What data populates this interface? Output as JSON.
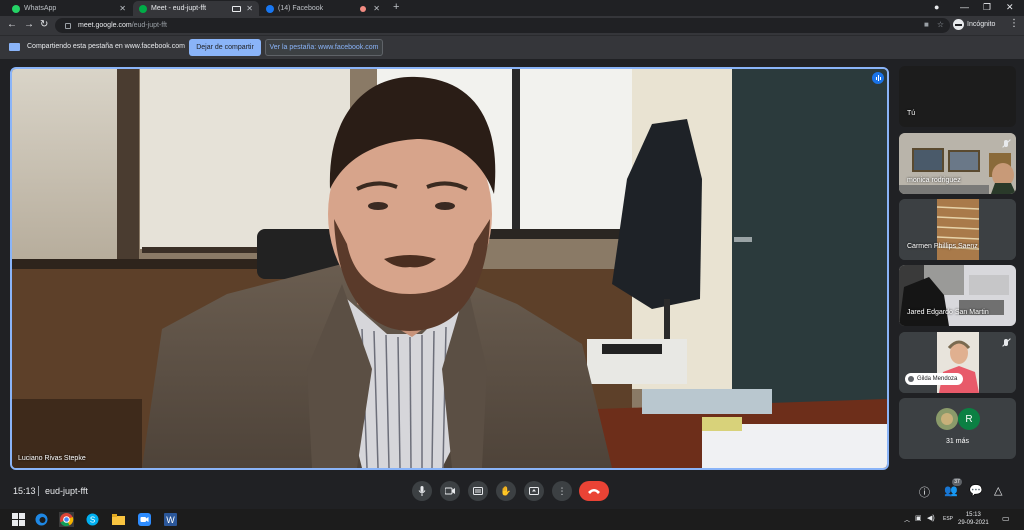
{
  "browser": {
    "tabs": [
      {
        "title": "WhatsApp",
        "favicon_color": "#25d366",
        "active": false
      },
      {
        "title": "Meet - eud-jupt-fft",
        "favicon_color": "#00ac47",
        "active": true
      },
      {
        "title": "(14) Facebook",
        "favicon_color": "#1877f2",
        "active": false
      }
    ],
    "new_tab_label": "+",
    "url_host": "meet.google.com",
    "url_path": "/eud-jupt-fft",
    "profile_label": "Incógnito"
  },
  "share_bar": {
    "message": "Compartiendo esta pestaña en www.facebook.com",
    "stop_label": "Dejar de compartir",
    "view_label": "Ver la pestaña: www.facebook.com"
  },
  "meeting": {
    "time": "15:13",
    "code": "eud-jupt-fft",
    "main_speaker": "Luciano Rivas Stepke",
    "participants": [
      {
        "name": "Tú",
        "muted": false
      },
      {
        "name": "monica rodriguez",
        "muted": true
      },
      {
        "name": "Carmen Phillips Saenz",
        "muted": false
      },
      {
        "name": "Jared Edgardo San Martin",
        "muted": false
      },
      {
        "name": "Gilda Mendoza",
        "muted": true
      }
    ],
    "more_tile": {
      "avatar_letter": "R",
      "label": "31 más"
    },
    "people_count": "37",
    "accent_color": "#8ab4f8",
    "end_call_color": "#ea4335"
  },
  "taskbar": {
    "language": "ESP",
    "time": "15:13",
    "date": "29-09-2021"
  }
}
